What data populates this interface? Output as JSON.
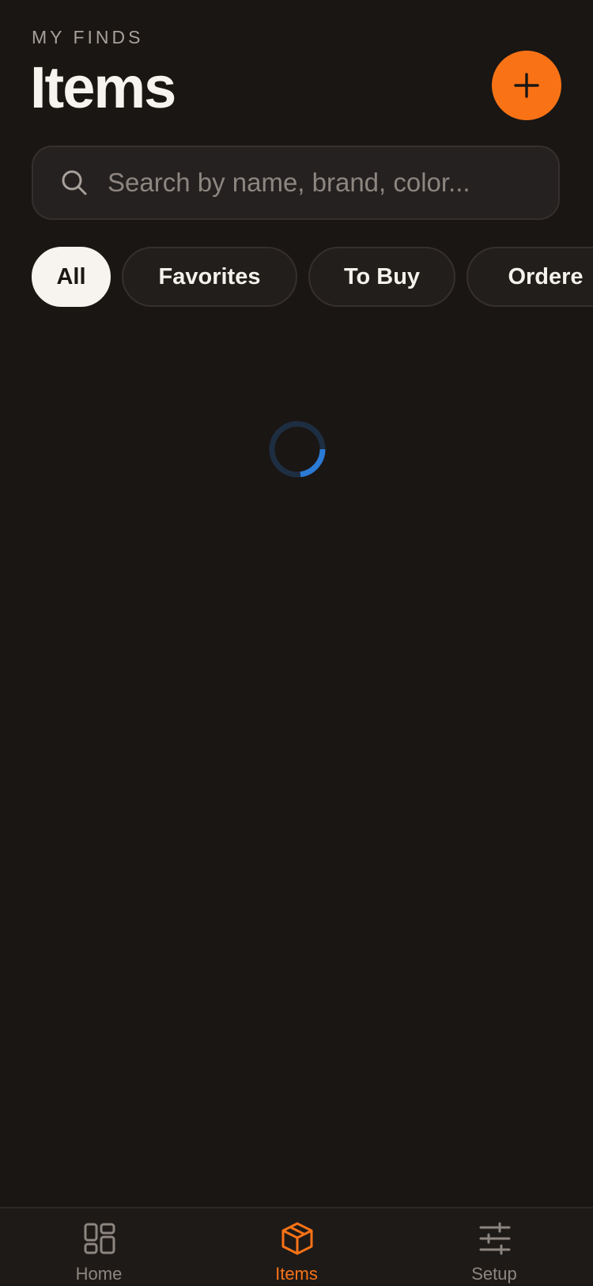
{
  "header": {
    "eyebrow": "MY FINDS",
    "title": "Items",
    "add_icon": "plus-icon"
  },
  "search": {
    "placeholder": "Search by name, brand, color...",
    "value": "",
    "icon": "search-icon"
  },
  "filters": {
    "selected": "All",
    "chips": [
      {
        "label": "All"
      },
      {
        "label": "Favorites"
      },
      {
        "label": "To Buy"
      },
      {
        "label": "Ordere"
      }
    ]
  },
  "loading": {
    "icon": "spinner-icon",
    "spinner_color": "#2b7bd6",
    "spinner_track_color": "#1e2e42"
  },
  "tab_bar": {
    "selected": "Items",
    "tabs": [
      {
        "label": "Home",
        "icon": "grid-icon"
      },
      {
        "label": "Items",
        "icon": "box-icon"
      },
      {
        "label": "Setup",
        "icon": "sliders-icon"
      }
    ]
  },
  "colors": {
    "background": "#1a1614",
    "accent": "#f97316",
    "chip_active_bg": "#f7f3ee",
    "muted_text": "#8d8680"
  }
}
